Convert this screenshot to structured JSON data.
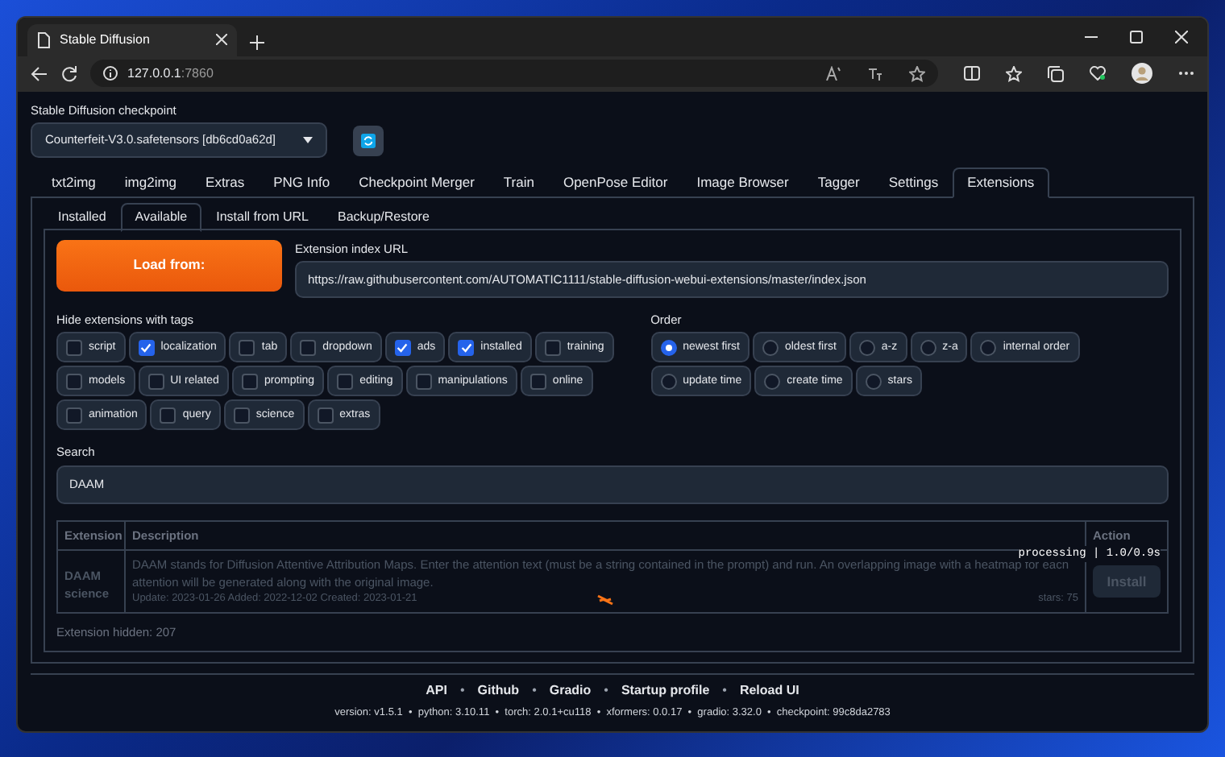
{
  "browser": {
    "tab_title": "Stable Diffusion",
    "url_host": "127.0.0.1",
    "url_port": ":7860"
  },
  "checkpoint": {
    "label": "Stable Diffusion checkpoint",
    "value": "Counterfeit-V3.0.safetensors [db6cd0a62d]"
  },
  "main_tabs": [
    {
      "label": "txt2img",
      "selected": false
    },
    {
      "label": "img2img",
      "selected": false
    },
    {
      "label": "Extras",
      "selected": false
    },
    {
      "label": "PNG Info",
      "selected": false
    },
    {
      "label": "Checkpoint Merger",
      "selected": false
    },
    {
      "label": "Train",
      "selected": false
    },
    {
      "label": "OpenPose Editor",
      "selected": false
    },
    {
      "label": "Image Browser",
      "selected": false
    },
    {
      "label": "Tagger",
      "selected": false
    },
    {
      "label": "Settings",
      "selected": false
    },
    {
      "label": "Extensions",
      "selected": true
    }
  ],
  "sub_tabs": [
    {
      "label": "Installed",
      "selected": false
    },
    {
      "label": "Available",
      "selected": true
    },
    {
      "label": "Install from URL",
      "selected": false
    },
    {
      "label": "Backup/Restore",
      "selected": false
    }
  ],
  "load_button": "Load from:",
  "index_url": {
    "label": "Extension index URL",
    "value": "https://raw.githubusercontent.com/AUTOMATIC1111/stable-diffusion-webui-extensions/master/index.json"
  },
  "hide_tags": {
    "label": "Hide extensions with tags",
    "items": [
      {
        "label": "script",
        "checked": false
      },
      {
        "label": "localization",
        "checked": true
      },
      {
        "label": "tab",
        "checked": false
      },
      {
        "label": "dropdown",
        "checked": false
      },
      {
        "label": "ads",
        "checked": true
      },
      {
        "label": "installed",
        "checked": true
      },
      {
        "label": "training",
        "checked": false
      },
      {
        "label": "models",
        "checked": false
      },
      {
        "label": "UI related",
        "checked": false
      },
      {
        "label": "prompting",
        "checked": false
      },
      {
        "label": "editing",
        "checked": false
      },
      {
        "label": "manipulations",
        "checked": false
      },
      {
        "label": "online",
        "checked": false
      },
      {
        "label": "animation",
        "checked": false
      },
      {
        "label": "query",
        "checked": false
      },
      {
        "label": "science",
        "checked": false
      },
      {
        "label": "extras",
        "checked": false
      }
    ]
  },
  "order": {
    "label": "Order",
    "options": [
      {
        "label": "newest first",
        "selected": true
      },
      {
        "label": "oldest first",
        "selected": false
      },
      {
        "label": "a-z",
        "selected": false
      },
      {
        "label": "z-a",
        "selected": false
      },
      {
        "label": "internal order",
        "selected": false
      },
      {
        "label": "update time",
        "selected": false
      },
      {
        "label": "create time",
        "selected": false
      },
      {
        "label": "stars",
        "selected": false
      }
    ]
  },
  "search": {
    "label": "Search",
    "value": "DAAM"
  },
  "table": {
    "columns": [
      "Extension",
      "Description",
      "Action"
    ],
    "rows": [
      {
        "name": "DAAM",
        "tag": "science",
        "description": "DAAM stands for Diffusion Attentive Attribution Maps. Enter the attention text (must be a string contained in the prompt) and run. An overlapping image with a heatmap for each attention will be generated along with the original image.",
        "dates": "Update: 2023-01-26 Added: 2022-12-02 Created: 2023-01-21",
        "stars": "stars: 75",
        "action": "Install",
        "disabled": true
      }
    ],
    "processing": "processing | 1.0/0.9s"
  },
  "hidden_count": "Extension hidden: 207",
  "footer": {
    "links": [
      "API",
      "Github",
      "Gradio",
      "Startup profile",
      "Reload UI"
    ],
    "separator": "•",
    "versions": "version: v1.5.1  •  python: 3.10.11  •  torch: 2.0.1+cu118  •  xformers: 0.0.17  •  gradio: 3.32.0  •  checkpoint: 99c8da2783"
  }
}
